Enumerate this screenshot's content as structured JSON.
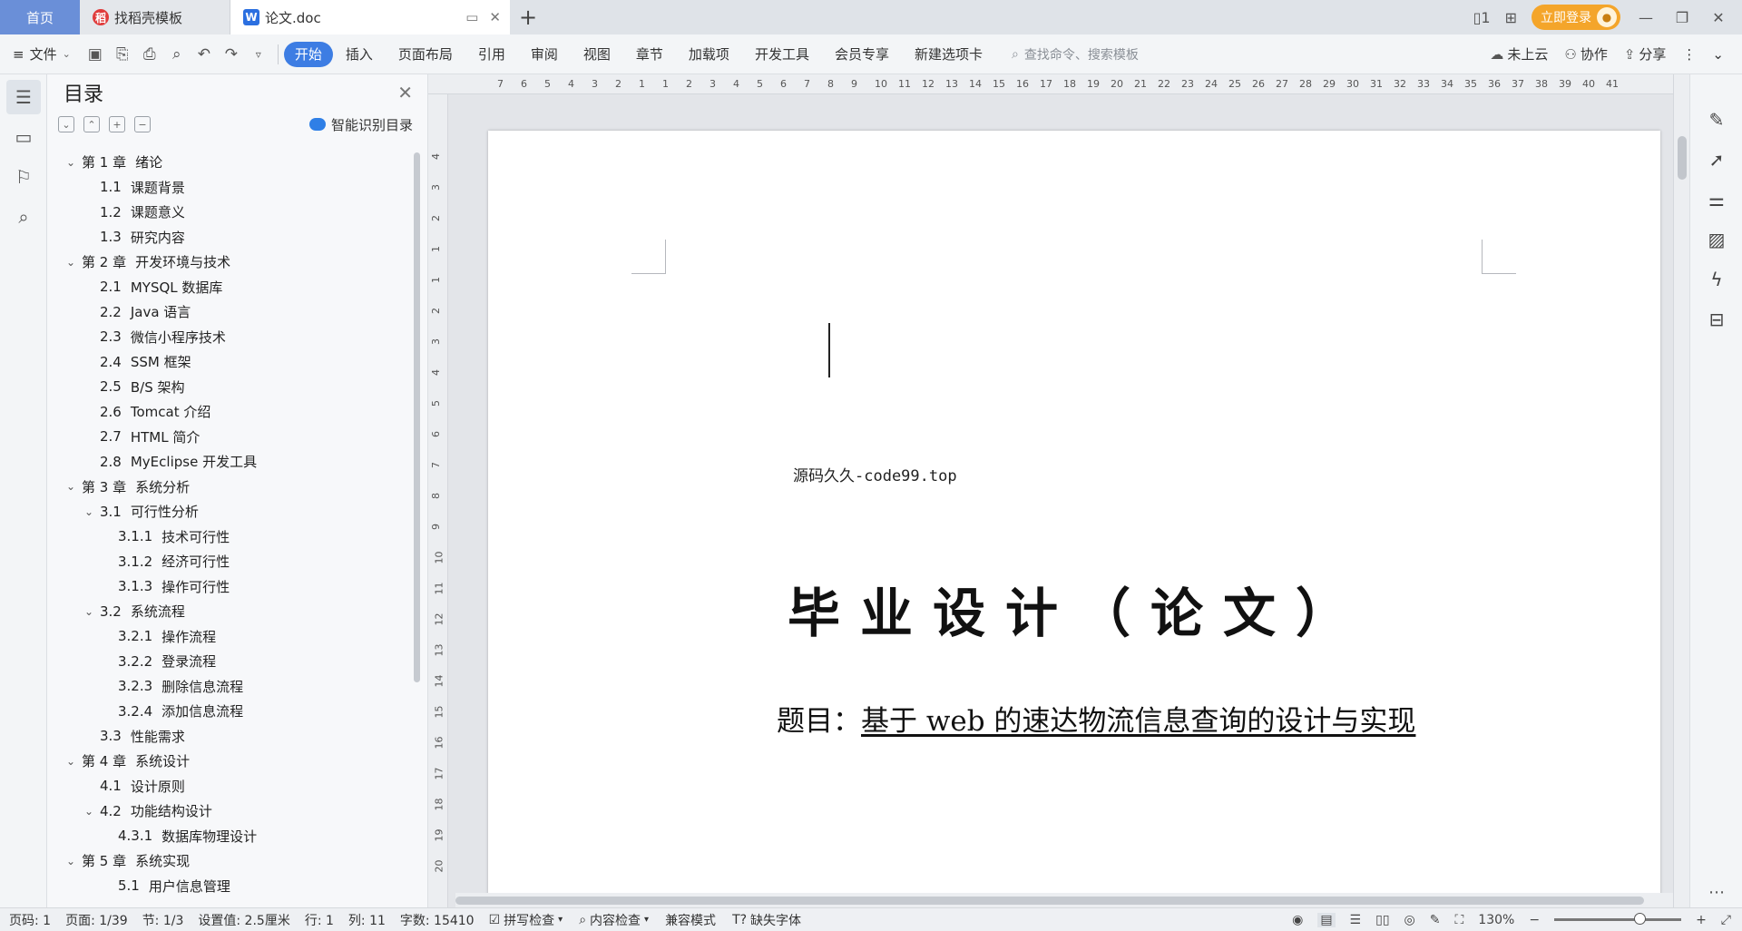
{
  "tabs": {
    "home": "首页",
    "template": "找稻壳模板",
    "active_doc": "论文.doc",
    "login": "立即登录"
  },
  "toolbar": {
    "file_menu": "文件",
    "ribbon": [
      "开始",
      "插入",
      "页面布局",
      "引用",
      "审阅",
      "视图",
      "章节",
      "加载项",
      "开发工具",
      "会员专享",
      "新建选项卡"
    ],
    "search_placeholder": "查找命令、搜索模板",
    "cloud": "未上云",
    "collab": "协作",
    "share": "分享"
  },
  "toc": {
    "title": "目录",
    "smart_label": "智能识别目录",
    "items": [
      {
        "level": 1,
        "num": "第 1 章",
        "text": "绪论",
        "expanded": true
      },
      {
        "level": 2,
        "num": "1.1",
        "text": "课题背景"
      },
      {
        "level": 2,
        "num": "1.2",
        "text": "课题意义"
      },
      {
        "level": 2,
        "num": "1.3",
        "text": "研究内容"
      },
      {
        "level": 1,
        "num": "第 2 章",
        "text": "开发环境与技术",
        "expanded": true
      },
      {
        "level": 2,
        "num": "2.1",
        "text": "MYSQL 数据库"
      },
      {
        "level": 2,
        "num": "2.2",
        "text": "Java 语言"
      },
      {
        "level": 2,
        "num": "2.3",
        "text": "微信小程序技术"
      },
      {
        "level": 2,
        "num": "2.4",
        "text": "SSM 框架"
      },
      {
        "level": 2,
        "num": "2.5",
        "text": "B/S 架构"
      },
      {
        "level": 2,
        "num": "2.6",
        "text": "Tomcat 介绍"
      },
      {
        "level": 2,
        "num": "2.7",
        "text": "HTML 简介"
      },
      {
        "level": 2,
        "num": "2.8",
        "text": "MyEclipse 开发工具"
      },
      {
        "level": 1,
        "num": "第 3 章",
        "text": "系统分析",
        "expanded": true
      },
      {
        "level": 2,
        "num": "3.1",
        "text": "可行性分析",
        "expanded": true
      },
      {
        "level": 3,
        "num": "3.1.1",
        "text": "技术可行性"
      },
      {
        "level": 3,
        "num": "3.1.2",
        "text": "经济可行性"
      },
      {
        "level": 3,
        "num": "3.1.3",
        "text": "操作可行性"
      },
      {
        "level": 2,
        "num": "3.2",
        "text": "系统流程",
        "expanded": true
      },
      {
        "level": 3,
        "num": "3.2.1",
        "text": "操作流程"
      },
      {
        "level": 3,
        "num": "3.2.2",
        "text": "登录流程"
      },
      {
        "level": 3,
        "num": "3.2.3",
        "text": "删除信息流程"
      },
      {
        "level": 3,
        "num": "3.2.4",
        "text": "添加信息流程"
      },
      {
        "level": 2,
        "num": "3.3",
        "text": "性能需求"
      },
      {
        "level": 1,
        "num": "第 4 章",
        "text": "系统设计",
        "expanded": true
      },
      {
        "level": 2,
        "num": "4.1",
        "text": "设计原则"
      },
      {
        "level": 2,
        "num": "4.2",
        "text": "功能结构设计",
        "expanded": true
      },
      {
        "level": 3,
        "num": "4.3.1",
        "text": "数据库物理设计"
      },
      {
        "level": 1,
        "num": "第 5 章",
        "text": "系统实现",
        "expanded": true
      },
      {
        "level": 3,
        "num": "5.1",
        "text": "用户信息管理"
      }
    ]
  },
  "ruler": {
    "h_labels": [
      "7",
      "6",
      "5",
      "4",
      "3",
      "2",
      "1",
      "1",
      "2",
      "3",
      "4",
      "5",
      "6",
      "7",
      "8",
      "9",
      "10",
      "11",
      "12",
      "13",
      "14",
      "15",
      "16",
      "17",
      "18",
      "19",
      "20",
      "21",
      "22",
      "23",
      "24",
      "25",
      "26",
      "27",
      "28",
      "29",
      "30",
      "31",
      "32",
      "33",
      "34",
      "35",
      "36",
      "37",
      "38",
      "39",
      "40",
      "41"
    ],
    "v_labels": [
      "4",
      "3",
      "2",
      "1",
      "1",
      "2",
      "3",
      "4",
      "5",
      "6",
      "7",
      "8",
      "9",
      "10",
      "11",
      "12",
      "13",
      "14",
      "15",
      "16",
      "17",
      "18",
      "19",
      "20"
    ]
  },
  "document": {
    "source_line": "源码久久-code99.top",
    "title": "毕业设计（论文）",
    "subject_label": "题目：",
    "subject_value": "基于 web 的速达物流信息查询的设计与实现"
  },
  "statusbar": {
    "page_code": "页码: 1",
    "page": "页面: 1/39",
    "section": "节: 1/3",
    "setting": "设置值: 2.5厘米",
    "row": "行: 1",
    "col": "列: 11",
    "words": "字数: 15410",
    "spell": "拼写检查",
    "content_check": "内容检查",
    "compat": "兼容模式",
    "missing_font": "缺失字体",
    "zoom": "130%"
  }
}
